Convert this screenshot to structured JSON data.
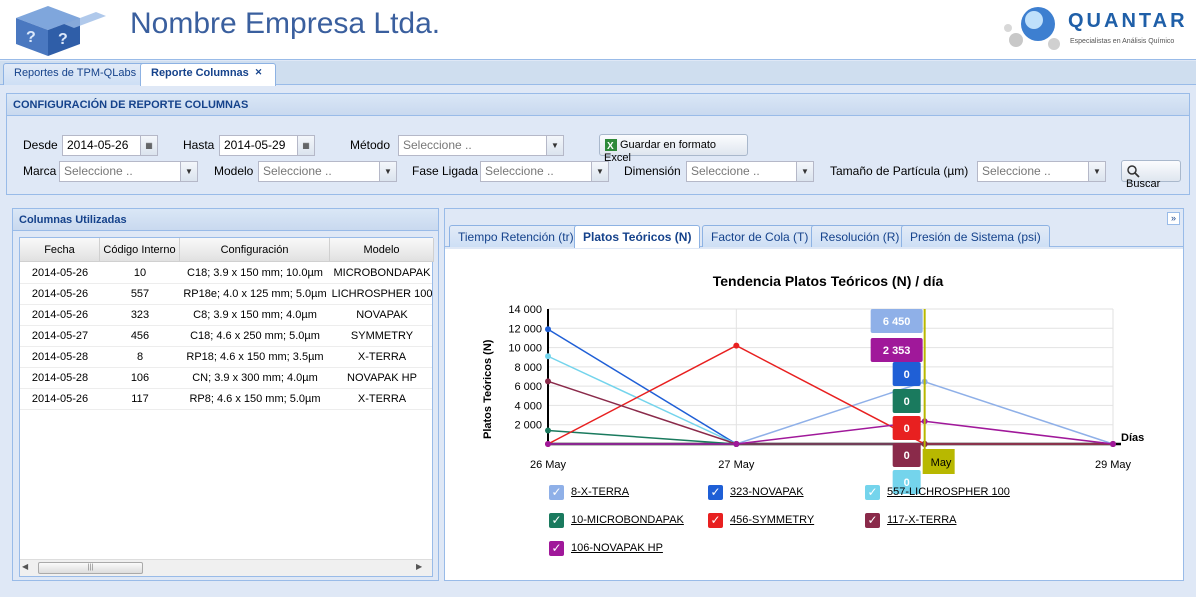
{
  "header": {
    "company": "Nombre Empresa Ltda.",
    "brand": "QUANTAR",
    "brand_sub": "Especialistas en Análisis Químico"
  },
  "tabs": [
    {
      "label": "Reportes de TPM-QLabs"
    },
    {
      "label": "Reporte Columnas"
    }
  ],
  "config": {
    "title": "CONFIGURACIÓN DE REPORTE COLUMNAS",
    "desde_label": "Desde",
    "desde_value": "2014-05-26",
    "hasta_label": "Hasta",
    "hasta_value": "2014-05-29",
    "metodo_label": "Método",
    "metodo_placeholder": "Seleccione ..",
    "excel_label": "Guardar en formato Excel",
    "marca_label": "Marca",
    "marca_placeholder": "Seleccione ..",
    "modelo_label": "Modelo",
    "modelo_placeholder": "Seleccione ..",
    "fase_label": "Fase Ligada",
    "fase_placeholder": "Seleccione ..",
    "dimension_label": "Dimensión",
    "dimension_placeholder": "Seleccione ..",
    "tamano_label": "Tamaño de Partícula (µm)",
    "tamano_placeholder": "Seleccione ..",
    "buscar_label": "Buscar"
  },
  "columns_panel": {
    "title": "Columnas Utilizadas",
    "headers": [
      "Fecha",
      "Código Interno",
      "Configuración",
      "Modelo"
    ],
    "rows": [
      [
        "2014-05-26",
        "10",
        "C18; 3.9 x 150 mm; 10.0µm",
        "MICROBONDAPAK"
      ],
      [
        "2014-05-26",
        "557",
        "RP18e; 4.0 x 125 mm; 5.0µm",
        "LICHROSPHER 100"
      ],
      [
        "2014-05-26",
        "323",
        "C8; 3.9 x 150 mm; 4.0µm",
        "NOVAPAK"
      ],
      [
        "2014-05-27",
        "456",
        "C18; 4.6 x 250 mm; 5.0µm",
        "SYMMETRY"
      ],
      [
        "2014-05-28",
        "8",
        "RP18; 4.6 x 150 mm; 3.5µm",
        "X-TERRA"
      ],
      [
        "2014-05-28",
        "106",
        "CN; 3.9 x 300 mm; 4.0µm",
        "NOVAPAK HP"
      ],
      [
        "2014-05-26",
        "117",
        "RP8; 4.6 x 150 mm; 5.0µm",
        "X-TERRA"
      ]
    ]
  },
  "chart_tabs": [
    "Tiempo Retención (tr)",
    "Platos Teóricos (N)",
    "Factor de Cola (T)",
    "Resolución (R)",
    "Presión de Sistema (psi)"
  ],
  "chart_data": {
    "type": "line",
    "title": "Tendencia Platos Teóricos (N) / día",
    "ylabel": "Platos Teóricos (N)",
    "xlabel": "Días",
    "categories": [
      "26 May",
      "27 May",
      "28 May",
      "29 May"
    ],
    "yticks": [
      "2 000",
      "4 000",
      "6 000",
      "8 000",
      "10 000",
      "12 000",
      "14 000"
    ],
    "ylim": [
      0,
      14000
    ],
    "series": [
      {
        "name": "8-X-TERRA",
        "color": "#8fb0e8",
        "values": [
          0,
          0,
          6450,
          0
        ]
      },
      {
        "name": "323-NOVAPAK",
        "color": "#1f5fd6",
        "values": [
          11900,
          0,
          0,
          0
        ]
      },
      {
        "name": "557-LICHROSPHER 100",
        "color": "#74d4ec",
        "values": [
          9100,
          0,
          0,
          0
        ]
      },
      {
        "name": "10-MICROBONDAPAK",
        "color": "#1a7a5e",
        "values": [
          1400,
          0,
          0,
          0
        ]
      },
      {
        "name": "456-SYMMETRY",
        "color": "#e82020",
        "values": [
          0,
          10200,
          0,
          0
        ]
      },
      {
        "name": "117-X-TERRA",
        "color": "#8a2a4a",
        "values": [
          6500,
          0,
          0,
          0
        ]
      },
      {
        "name": "106-NOVAPAK HP",
        "color": "#a0189a",
        "values": [
          0,
          0,
          2353,
          0
        ]
      }
    ],
    "tooltip_labels": [
      {
        "text": "6 450",
        "color": "#8fb0e8"
      },
      {
        "text": "2 353",
        "color": "#a0189a"
      },
      {
        "text": "0",
        "color": "#1f5fd6"
      },
      {
        "text": "0",
        "color": "#1a7a5e"
      },
      {
        "text": "0",
        "color": "#e82020"
      },
      {
        "text": "0",
        "color": "#8a2a4a"
      },
      {
        "text": "0",
        "color": "#74d4ec"
      }
    ],
    "x_marker_label": "May",
    "grid": true,
    "legend": "bottom"
  }
}
